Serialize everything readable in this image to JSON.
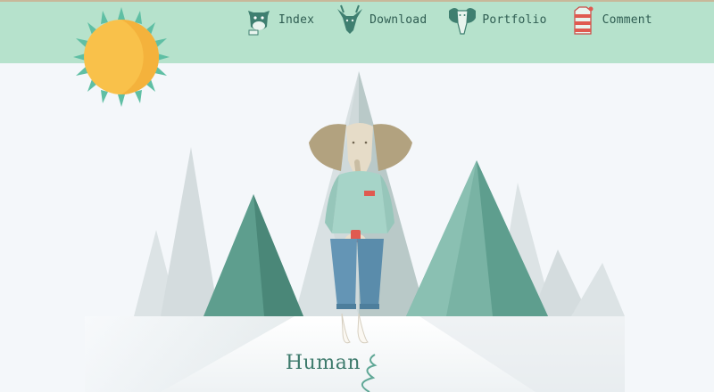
{
  "nav": {
    "items": [
      {
        "label": "Index",
        "icon": "cow-head-icon"
      },
      {
        "label": "Download",
        "icon": "deer-head-icon"
      },
      {
        "label": "Portfolio",
        "icon": "elephant-head-icon"
      },
      {
        "label": "Comment",
        "icon": "shirt-icon"
      }
    ]
  },
  "hero": {
    "title": "Human"
  },
  "colors": {
    "topbar": "#b6e2cc",
    "mountain_dark": "#4f9484",
    "mountain_light": "#d5dee0",
    "sun": "#f9c14a",
    "sun_rays": "#5fbfa4",
    "text_accent": "#3d7a6c"
  }
}
